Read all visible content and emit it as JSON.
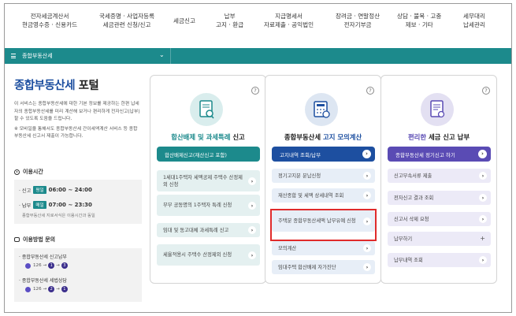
{
  "nav": [
    {
      "line1": "전자세금계산서",
      "line2": "현금영수증 · 신용카드"
    },
    {
      "line1": "국세증명 · 사업자등록",
      "line2": "세금관련 신청/신고"
    },
    {
      "line1": "세금신고",
      "line2": ""
    },
    {
      "line1": "납부",
      "line2": "고지 · 환급"
    },
    {
      "line1": "지급명세서",
      "line2": "자료제출 · 공익법인"
    },
    {
      "line1": "장려금 · 연말정산",
      "line2": "전자기부금"
    },
    {
      "line1": "상담 · 불복 · 고충",
      "line2": "제보 · 기타"
    },
    {
      "line1": "세무대리",
      "line2": "납세관리"
    }
  ],
  "breadcrumb": {
    "label": "종합부동산세",
    "chevron": "⌄"
  },
  "portal": {
    "title_main": "종합부동산세",
    "title_plain": " 포털",
    "intro": "이 서비스는 종합부동산세에 대한 기본 정보를 제공하는 한편 납세자의 종합부동산세를 미리 계산해 보거나 편리하게 전자신고(납부) 할 수 있도록 도움을 드립니다.",
    "intro2": "※ 모바일을 통해서도 종합부동산세 간이세액계산 서비스 등 종합부동산세 신고서 제출이 가능합니다.",
    "hours_heading": "이용시간",
    "hours": [
      {
        "label": "· 신고",
        "tag": "평일",
        "time": "06:00 ~ 24:00"
      },
      {
        "label": "· 납부",
        "tag": "매일",
        "time": "07:00 ~ 23:30"
      }
    ],
    "hours_note": "종합부동산세 지로서식은 이용시간과 동일",
    "inquiry_heading": "이용방법 문의",
    "inquiries": [
      {
        "label": "· 종합부동산세 신고납부",
        "phone": "126",
        "steps": [
          "1",
          "3"
        ]
      },
      {
        "label": "· 종합부동산세 세법상담",
        "phone": "126",
        "steps": [
          "2",
          "1"
        ]
      }
    ]
  },
  "cards": [
    {
      "title_hl": "합산배제 및 과세특례",
      "title_rest": " 신고",
      "main_button": "합산배제신고(재산신고 포함)",
      "items": [
        {
          "label": "1세대1주택자 세액공제 주택수 산정제외 신청",
          "action": "arrow"
        },
        {
          "label": "부부 공동명의 1주택자 특례 신청",
          "action": "arrow"
        },
        {
          "label": "임대 및 동고대체 과세특례 신고",
          "action": "arrow"
        },
        {
          "label": "세율적용시 주택수 산정제외 신청",
          "action": "arrow"
        }
      ],
      "help": "?"
    },
    {
      "title_pre": "종합부동산세 ",
      "title_hl": "고지 모의계산",
      "main_button": "고지내역 조회/납부",
      "items": [
        {
          "label": "정기고지분 분납신청",
          "action": "arrow"
        },
        {
          "label": "재산종합 및 세액 상세내역 조회",
          "action": "arrow"
        },
        {
          "label": "주택분 종합부동산세액 납부유예 신청",
          "action": "arrow"
        },
        {
          "label": "모의계산",
          "action": "arrow"
        },
        {
          "label": "임대주택 합산배제 자가진단",
          "action": "arrow"
        }
      ],
      "help": "?"
    },
    {
      "title_hl": "편리한",
      "title_rest": " 세금 신고 납부",
      "main_button": "종합부동산세 정기신고 하기",
      "items": [
        {
          "label": "신고부속서류 제출",
          "action": "arrow"
        },
        {
          "label": "전자신고 결과 조회",
          "action": "arrow"
        },
        {
          "label": "신고서 삭제 요청",
          "action": "arrow"
        },
        {
          "label": "납부하기",
          "action": "plus"
        },
        {
          "label": "납부내역 조회",
          "action": "arrow"
        }
      ],
      "help": "?"
    }
  ],
  "colors": {
    "teal": "#1c8a8c",
    "blue": "#1d4fa0",
    "purple": "#5a4bb4",
    "highlight": "#e02b2b"
  },
  "icons": {
    "arrow": "›",
    "plus": "+"
  }
}
